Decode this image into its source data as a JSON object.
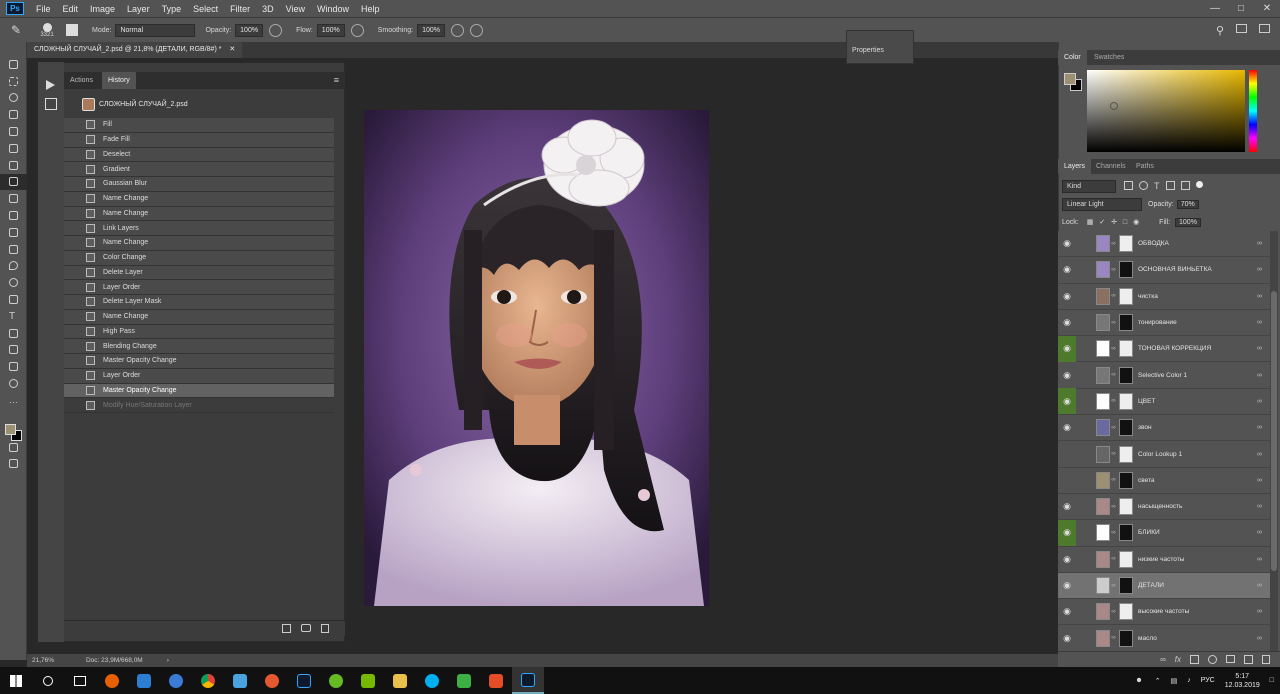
{
  "menubar": {
    "app_badge": "Ps",
    "items": [
      "File",
      "Edit",
      "Image",
      "Layer",
      "Type",
      "Select",
      "Filter",
      "3D",
      "View",
      "Window",
      "Help"
    ]
  },
  "options": {
    "brush_size": "3321",
    "mode_label": "Mode:",
    "mode_value": "Normal",
    "opacity_label": "Opacity:",
    "opacity_value": "100%",
    "flow_label": "Flow:",
    "flow_value": "100%",
    "smoothing_label": "Smoothing:",
    "smoothing_value": "100%"
  },
  "document": {
    "tab_title": "СЛОЖНЫЙ СЛУЧАЙ_2.psd @ 21,8% (ДЕТАЛИ, RGB/8#) *"
  },
  "properties": {
    "label": "Properties"
  },
  "history_panel": {
    "tabs": [
      "Actions",
      "History"
    ],
    "active_tab": "History",
    "snapshot_name": "СЛОЖНЫЙ СЛУЧАЙ_2.psd",
    "states": [
      "Fill",
      "Fade Fill",
      "Deselect",
      "Gradient",
      "Gaussian Blur",
      "Name Change",
      "Name Change",
      "Link Layers",
      "Name Change",
      "Color Change",
      "Delete Layer",
      "Layer Order",
      "Delete Layer Mask",
      "Name Change",
      "High Pass",
      "Blending Change",
      "Master Opacity Change",
      "Layer Order",
      "Master Opacity Change",
      "Modify Hue/Saturation Layer"
    ],
    "selected_index": 18,
    "undone_index": 19
  },
  "color_panel": {
    "tabs": [
      "Color",
      "Swatches"
    ],
    "fg": "#9c9073",
    "bg": "#000000"
  },
  "layers_panel": {
    "tabs": [
      "Layers",
      "Channels",
      "Paths"
    ],
    "filter": "Kind",
    "blend_mode": "Linear Light",
    "opacity_label": "Opacity:",
    "opacity_value": "70%",
    "lock_label": "Lock:",
    "fill_label": "Fill:",
    "fill_value": "100%",
    "layers": [
      {
        "name": "ОБВОДКА",
        "eye": true,
        "green": false
      },
      {
        "name": "ОСНОВНАЯ ВИНЬЕТКА",
        "eye": true,
        "green": false
      },
      {
        "name": "чистка",
        "eye": true,
        "green": false
      },
      {
        "name": "тонирование",
        "eye": true,
        "green": false
      },
      {
        "name": "ТОНОВАЯ КОРРЕКЦИЯ",
        "eye": true,
        "green": true
      },
      {
        "name": "Selective Color 1",
        "eye": true,
        "green": false
      },
      {
        "name": "ЦВЕТ",
        "eye": true,
        "green": true
      },
      {
        "name": "звон",
        "eye": true,
        "green": false
      },
      {
        "name": "Color Lookup 1",
        "eye": false,
        "green": false
      },
      {
        "name": "света",
        "eye": false,
        "green": false
      },
      {
        "name": "насыщенность",
        "eye": true,
        "green": false
      },
      {
        "name": "БЛИКИ",
        "eye": true,
        "green": true
      },
      {
        "name": "низкие частоты",
        "eye": true,
        "green": false
      },
      {
        "name": "ДЕТАЛИ",
        "eye": true,
        "green": false
      },
      {
        "name": "высокие частоты",
        "eye": true,
        "green": false
      },
      {
        "name": "масло",
        "eye": true,
        "green": false
      }
    ],
    "selected_index": 13
  },
  "statusbar": {
    "zoom": "21,76%",
    "doc_size": "Doc: 23,9M/668,0M"
  },
  "taskbar": {
    "lang": "РУС",
    "time": "5:17",
    "date": "12.03.2019"
  }
}
